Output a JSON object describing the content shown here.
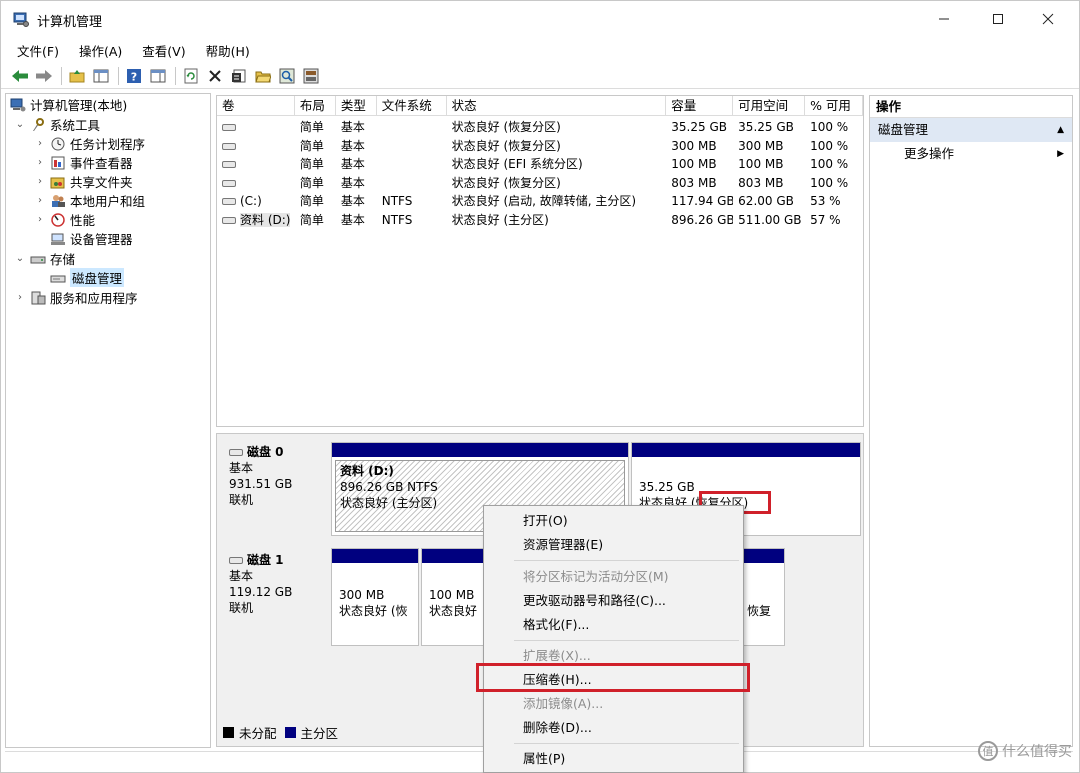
{
  "window": {
    "title": "计算机管理"
  },
  "menu": [
    "文件(F)",
    "操作(A)",
    "查看(V)",
    "帮助(H)"
  ],
  "toolbar_icons": [
    "back-icon",
    "forward-icon",
    "up-folder-icon",
    "show-hide-tree-icon",
    "help-icon",
    "properties-pane-icon",
    "refresh-icon",
    "delete-icon",
    "properties-icon",
    "open-icon",
    "search-icon",
    "settings-icon"
  ],
  "tree": [
    {
      "label": "计算机管理(本地)",
      "level": 0,
      "arrow": "",
      "icon": "computer-management-icon"
    },
    {
      "label": "系统工具",
      "level": 1,
      "arrow": "⌄",
      "icon": "system-tools-icon"
    },
    {
      "label": "任务计划程序",
      "level": 2,
      "arrow": "›",
      "icon": "task-scheduler-icon"
    },
    {
      "label": "事件查看器",
      "level": 2,
      "arrow": "›",
      "icon": "event-viewer-icon"
    },
    {
      "label": "共享文件夹",
      "level": 2,
      "arrow": "›",
      "icon": "shared-folders-icon"
    },
    {
      "label": "本地用户和组",
      "level": 2,
      "arrow": "›",
      "icon": "local-users-icon"
    },
    {
      "label": "性能",
      "level": 2,
      "arrow": "›",
      "icon": "performance-icon"
    },
    {
      "label": "设备管理器",
      "level": 2,
      "arrow": "",
      "icon": "device-manager-icon"
    },
    {
      "label": "存储",
      "level": 1,
      "arrow": "⌄",
      "icon": "storage-icon"
    },
    {
      "label": "磁盘管理",
      "level": 2,
      "arrow": "",
      "icon": "disk-management-icon",
      "selected": true
    },
    {
      "label": "服务和应用程序",
      "level": 1,
      "arrow": "›",
      "icon": "services-apps-icon"
    }
  ],
  "volumes": {
    "columns": [
      "卷",
      "布局",
      "类型",
      "文件系统",
      "状态",
      "容量",
      "可用空间",
      "% 可用"
    ],
    "rows": [
      [
        "",
        "简单",
        "基本",
        "",
        "状态良好 (恢复分区)",
        "35.25 GB",
        "35.25 GB",
        "100 %"
      ],
      [
        "",
        "简单",
        "基本",
        "",
        "状态良好 (恢复分区)",
        "300 MB",
        "300 MB",
        "100 %"
      ],
      [
        "",
        "简单",
        "基本",
        "",
        "状态良好 (EFI 系统分区)",
        "100 MB",
        "100 MB",
        "100 %"
      ],
      [
        "",
        "简单",
        "基本",
        "",
        "状态良好 (恢复分区)",
        "803 MB",
        "803 MB",
        "100 %"
      ],
      [
        "(C:)",
        "简单",
        "基本",
        "NTFS",
        "状态良好 (启动, 故障转储, 主分区)",
        "117.94 GB",
        "62.00 GB",
        "53 %"
      ],
      [
        "资料 (D:)",
        "简单",
        "基本",
        "NTFS",
        "状态良好 (主分区)",
        "896.26 GB",
        "511.00 GB",
        "57 %"
      ]
    ]
  },
  "disks": [
    {
      "name": "磁盘 0",
      "type": "基本",
      "size": "931.51 GB",
      "status": "联机",
      "partitions": [
        {
          "title": "资料  (D:)",
          "line1": "896.26 GB NTFS",
          "line2": "状态良好 (主分区)"
        },
        {
          "title": "",
          "line1": "35.25 GB",
          "line2": "状态良好 (恢复分区)"
        }
      ]
    },
    {
      "name": "磁盘 1",
      "type": "基本",
      "size": "119.12 GB",
      "status": "联机",
      "partitions": [
        {
          "line1": "300 MB",
          "line2": "状态良好 (恢"
        },
        {
          "line1": "100 MB",
          "line2": "状态良好"
        },
        {
          "line1": "",
          "line2": "恢复"
        }
      ]
    }
  ],
  "legend": [
    {
      "label": "未分配",
      "color": "#000000"
    },
    {
      "label": "主分区",
      "color": "#00007f"
    }
  ],
  "actions": {
    "header": "操作",
    "section": "磁盘管理",
    "items": [
      "更多操作"
    ]
  },
  "context_menu": [
    {
      "label": "打开(O)",
      "enabled": true
    },
    {
      "label": "资源管理器(E)",
      "enabled": true
    },
    {
      "sep": true
    },
    {
      "label": "将分区标记为活动分区(M)",
      "enabled": false
    },
    {
      "label": "更改驱动器号和路径(C)...",
      "enabled": true
    },
    {
      "label": "格式化(F)...",
      "enabled": true
    },
    {
      "sep": true
    },
    {
      "label": "扩展卷(X)...",
      "enabled": false
    },
    {
      "label": "压缩卷(H)...",
      "enabled": true,
      "highlighted": true
    },
    {
      "label": "添加镜像(A)...",
      "enabled": false
    },
    {
      "label": "删除卷(D)...",
      "enabled": true
    },
    {
      "sep": true
    },
    {
      "label": "属性(P)",
      "enabled": true
    }
  ],
  "watermark": "什么值得买",
  "colors": {
    "partition_bar": "#00007f",
    "highlight_box": "#d0202a",
    "selection": "#cce8ff",
    "actions_section": "#dfe8f4"
  }
}
